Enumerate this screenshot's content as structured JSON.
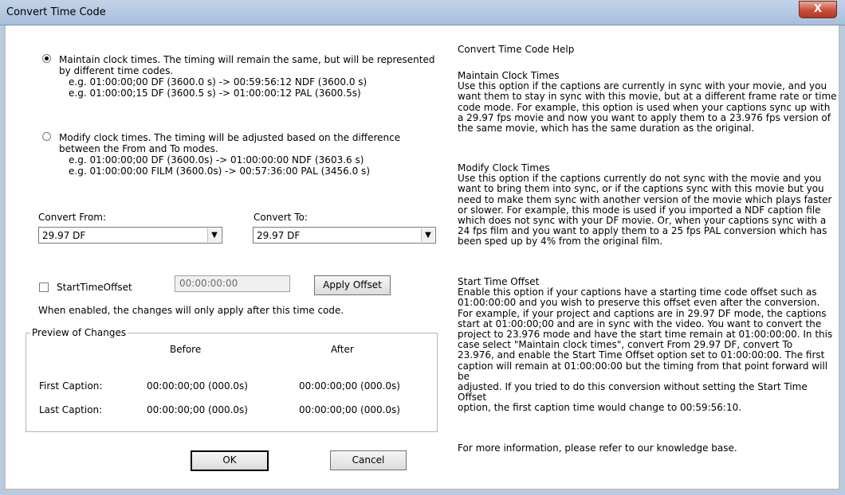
{
  "window": {
    "title": "Convert Time Code",
    "close_glyph": "X"
  },
  "maintain": {
    "label_line1": "Maintain clock times.  The timing will remain the same, but will be represented",
    "label_line2": "by different time codes.",
    "example1": "e.g.  01:00:00;00 DF (3600.0 s) -> 00:59:56:12 NDF (3600.0 s)",
    "example2": "e.g. 01:00:00;15 DF (3600.5 s) -> 01:00:00:12 PAL (3600.5s)",
    "selected": true
  },
  "modify": {
    "label_line1": "Modify clock times. The timing will be adjusted based on the difference",
    "label_line2": "between the From and To modes.",
    "example1": "e.g. 01:00:00;00 DF (3600.0s) -> 01:00:00:00 NDF (3603.6 s)",
    "example2": "e.g. 01:00:00:00 FILM (3600.0s) -> 00:57:36:00 PAL (3456.0 s)",
    "selected": false
  },
  "convert_from": {
    "label": "Convert From:",
    "value": "29.97 DF"
  },
  "convert_to": {
    "label": "Convert To:",
    "value": "29.97 DF"
  },
  "offset": {
    "checkbox_label": "StartTimeOffset",
    "checked": false,
    "value": "00:00:00:00",
    "apply_label": "Apply Offset",
    "note": "When enabled, the changes will only apply after this time code."
  },
  "preview": {
    "group_title": "Preview of Changes",
    "before_header": "Before",
    "after_header": "After",
    "rows": [
      {
        "label": "First Caption:",
        "before": "00:00:00;00 (000.0s)",
        "after": "00:00:00;00 (000.0s)"
      },
      {
        "label": "Last Caption:",
        "before": "00:00:00;00 (000.0s)",
        "after": "00:00:00;00 (000.0s)"
      }
    ]
  },
  "buttons": {
    "ok": "OK",
    "cancel": "Cancel"
  },
  "help": {
    "title": "Convert Time Code Help",
    "maintain_heading": "Maintain Clock Times",
    "maintain_lines": [
      "Use this option if the captions are currently in sync with your movie, and you",
      "want them to stay in sync with this movie, but at a different frame rate or time",
      "code mode. For example, this option is used when your captions sync up with",
      "a 29.97 fps movie and now you want to apply them to a 23.976 fps version of",
      "the same movie, which has the same duration as the original."
    ],
    "modify_heading": "Modify Clock Times",
    "modify_lines": [
      "Use this option if the captions currently do not sync with the movie and you",
      "want to bring them into sync, or if the captions sync with this movie but you",
      "need to make them sync with another version of the movie which plays faster",
      "or slower. For example, this mode is used if you imported a NDF caption file",
      "which does not sync with your DF movie. Or, when your captions sync with a",
      "24 fps film and you want to apply them to a 25 fps PAL conversion which has",
      "been sped up by 4% from the original film."
    ],
    "offset_heading": "Start Time Offset",
    "offset_lines": [
      "Enable this option if your captions have a starting time code offset such as",
      "01:00:00:00 and you wish to preserve this offset even after the conversion.",
      "For example, if your project and captions are in 29.97 DF mode, the captions",
      "start at 01:00:00;00 and are in sync with the video. You want to convert the",
      "project to 23.976 mode and have the start time remain at 01:00:00:00. In this",
      "case select \"Maintain clock times\", convert From 29.97 DF, convert To",
      "23.976, and enable the Start Time Offset option set to 01:00:00:00.  The first",
      "caption will remain at 01:00:00:00 but the timing from that point forward will be",
      "adjusted. If you tried to do this conversion without setting the Start Time Offset",
      "option, the first caption time would change to 00:59:56:10."
    ],
    "more_info": "For more information, please refer to our knowledge base."
  }
}
